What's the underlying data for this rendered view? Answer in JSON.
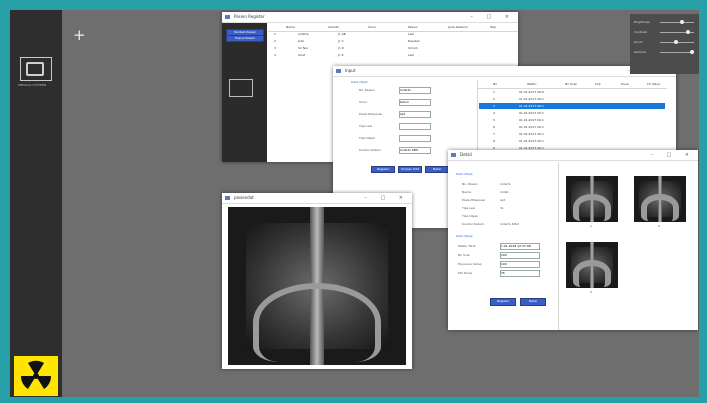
{
  "leftbar": {
    "logo_caption": "MEDICAL SYSTEMS"
  },
  "desktop": {
    "background": "#6e6e6e",
    "accent_border": "#26a0a6"
  },
  "patient_window": {
    "title": "Pasien Register",
    "buttons": [
      "Tambah Pasien",
      "Hapus Pasien"
    ],
    "columns": [
      "Nama",
      "Alamat",
      "Umur",
      "Pasien",
      "Jenis Kelamin",
      "Telp"
    ],
    "rows": [
      [
        "1",
        "Indarto",
        "Jl. AB",
        "Laki",
        "L",
        "0812"
      ],
      [
        "2",
        "Joko",
        "Jl. C",
        "Rujukan",
        "L",
        "0813"
      ],
      [
        "3",
        "Sri Nur",
        "Jl. D",
        "Umum",
        "P",
        "0814"
      ],
      [
        "4",
        "Arief",
        "Jl. E",
        "Laki",
        "L",
        "0815"
      ]
    ]
  },
  "form_window": {
    "title": "Input",
    "section": "Data Objek",
    "fields": [
      {
        "label": "No. Pasien",
        "value": "Indarto"
      },
      {
        "label": "Umur",
        "value": "tahun"
      },
      {
        "label": "Posisi Eksposisi",
        "value": "Apt"
      },
      {
        "label": "Tipe Lesi",
        "value": ""
      },
      {
        "label": "Tipe Objek",
        "value": ""
      },
      {
        "label": "Kondisi Sistem",
        "value": "Indarto KBit"
      }
    ],
    "buttons": [
      "Register",
      "Simpan Edit",
      "Batal"
    ],
    "table_header": [
      "No",
      "Waktu",
      "No Scan",
      "kVp",
      "Dose",
      "kV Value"
    ],
    "rows": [
      [
        "1",
        "01.01.2017 09:0"
      ],
      [
        "2",
        "01.01.2017 09:1"
      ],
      [
        "3",
        "01.01.2017 09:1"
      ],
      [
        "4",
        "01.01.2017 09:1"
      ],
      [
        "5",
        "01.01.2017 09:1"
      ],
      [
        "6",
        "01.01.2017 09:1"
      ],
      [
        "7",
        "01.01.2017 09:1"
      ],
      [
        "8",
        "01.01.2017 09:1"
      ],
      [
        "9",
        "01.01.2017 09:1"
      ],
      [
        "10",
        "01.01.2017 09:1"
      ]
    ]
  },
  "detail_window": {
    "title": "Detail",
    "section1": "Data Objek",
    "labels": [
      "No. Pasien",
      "Nama",
      "Posisi Eksposisi",
      "Tipe Lesi",
      "Tipe Objek",
      "Kondisi Sistem"
    ],
    "values": [
      "Indarto",
      "Indah",
      "Apt",
      "Ya",
      "",
      "Indarto Ktbit"
    ],
    "section2": "Data Objek",
    "labels2": [
      "Waktu Tarik",
      "No Scan",
      "Exposure Setup",
      "Mtr Dosis"
    ],
    "values2": [
      "1.01.2018 12:37:08",
      "100",
      "100",
      "35"
    ],
    "buttons": [
      "Register",
      "Batal"
    ],
    "thumb_labels": [
      "1",
      "2",
      "3"
    ]
  },
  "xray_window": {
    "title": "pasiendat"
  },
  "right_panel": {
    "labels": [
      "Brightness",
      "Contrast",
      "Zoom",
      "Gamma"
    ]
  }
}
